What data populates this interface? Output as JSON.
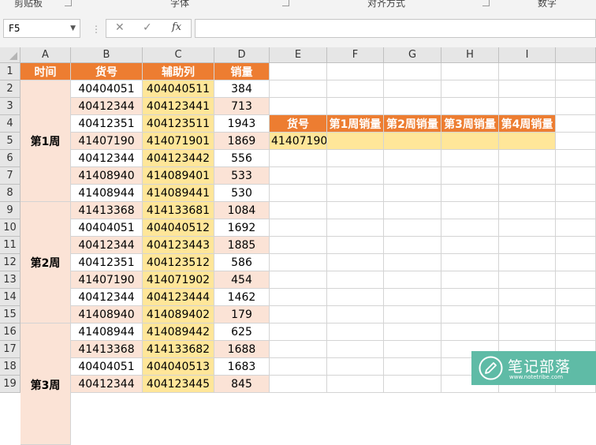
{
  "ribbon": {
    "groups": [
      "剪贴板",
      "字体",
      "对齐方式",
      "数字"
    ]
  },
  "formula_bar": {
    "name_box": "F5",
    "cancel_symbol": "✕",
    "enter_symbol": "✓",
    "fx_symbol": "fx",
    "formula": ""
  },
  "columns": [
    "A",
    "B",
    "C",
    "D",
    "E",
    "F",
    "G",
    "H",
    "I"
  ],
  "rows": [
    "1",
    "2",
    "3",
    "4",
    "5",
    "6",
    "7",
    "8",
    "9",
    "10",
    "11",
    "12",
    "13",
    "14",
    "15",
    "16",
    "17",
    "18",
    "19"
  ],
  "sheet": {
    "headers": [
      "时间",
      "货号",
      "辅助列",
      "销量"
    ],
    "weeks": [
      "第1周",
      "第2周",
      "第3周"
    ],
    "records": [
      [
        "40404051",
        "404040511",
        "384"
      ],
      [
        "40412344",
        "404123441",
        "713"
      ],
      [
        "40412351",
        "404123511",
        "1943"
      ],
      [
        "41407190",
        "414071901",
        "1869"
      ],
      [
        "40412344",
        "404123442",
        "556"
      ],
      [
        "41408940",
        "414089401",
        "533"
      ],
      [
        "41408944",
        "414089441",
        "530"
      ],
      [
        "41413368",
        "414133681",
        "1084"
      ],
      [
        "40404051",
        "404040512",
        "1692"
      ],
      [
        "40412344",
        "404123443",
        "1885"
      ],
      [
        "40412351",
        "404123512",
        "586"
      ],
      [
        "41407190",
        "414071902",
        "454"
      ],
      [
        "40412344",
        "404123444",
        "1462"
      ],
      [
        "41408940",
        "414089402",
        "179"
      ],
      [
        "41408944",
        "414089442",
        "625"
      ],
      [
        "41413368",
        "414133682",
        "1688"
      ],
      [
        "40404051",
        "404040513",
        "1683"
      ],
      [
        "40412344",
        "404123445",
        "845"
      ]
    ]
  },
  "lookup": {
    "headers": [
      "货号",
      "第1周销量",
      "第2周销量",
      "第3周销量",
      "第4周销量"
    ],
    "values": [
      "41407190",
      "",
      "",
      "",
      ""
    ]
  },
  "watermark": {
    "title": "笔记部落",
    "url": "www.notetribe.com"
  },
  "colors": {
    "header_orange": "#ed7d31",
    "peach": "#fbe3d6",
    "yellow": "#ffe699",
    "watermark": "#5fbba6"
  }
}
